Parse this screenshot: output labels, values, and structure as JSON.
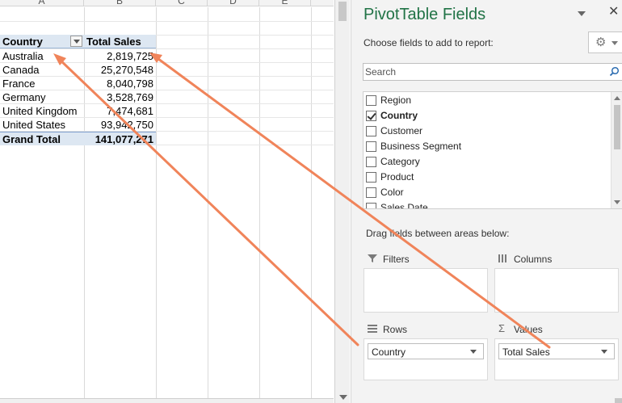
{
  "sheet": {
    "columns": [
      "A",
      "B",
      "C",
      "D",
      "E"
    ],
    "pivot": {
      "header": {
        "row_label": "Country",
        "value_label": "Total Sales"
      },
      "rows": [
        {
          "country": "Australia",
          "sales": "2,819,725"
        },
        {
          "country": "Canada",
          "sales": "25,270,548"
        },
        {
          "country": "France",
          "sales": "8,040,798"
        },
        {
          "country": "Germany",
          "sales": "3,528,769"
        },
        {
          "country": "United Kingdom",
          "sales": "7,474,681"
        },
        {
          "country": "United States",
          "sales": "93,942,750"
        }
      ],
      "total": {
        "label": "Grand Total",
        "sales": "141,077,271"
      }
    }
  },
  "pane": {
    "title": "PivotTable Fields",
    "close": "✕",
    "choose_text": "Choose fields to add to report:",
    "search_placeholder": "Search",
    "fields": [
      {
        "label": "Region",
        "checked": false
      },
      {
        "label": "Country",
        "checked": true
      },
      {
        "label": "Customer",
        "checked": false
      },
      {
        "label": "Business Segment",
        "checked": false
      },
      {
        "label": "Category",
        "checked": false
      },
      {
        "label": "Product",
        "checked": false
      },
      {
        "label": "Color",
        "checked": false
      },
      {
        "label": "Sales Date",
        "checked": false
      }
    ],
    "drag_text": "Drag fields between areas below:",
    "areas": {
      "filters": {
        "title": "Filters",
        "icon": "filter-icon"
      },
      "columns": {
        "title": "Columns",
        "icon": "columns-icon"
      },
      "rows": {
        "title": "Rows",
        "icon": "rows-icon",
        "item": "Country"
      },
      "values": {
        "title": "Values",
        "icon": "sigma-icon",
        "item": "Total Sales"
      }
    }
  },
  "colors": {
    "pane_title": "#217346",
    "pivot_header_bg": "#dde7f2",
    "arrow": "#f0845a"
  }
}
